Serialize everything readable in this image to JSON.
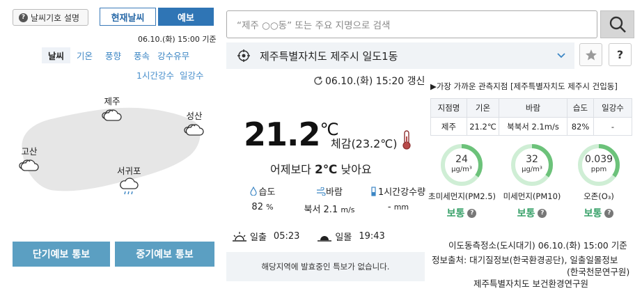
{
  "left": {
    "legend_btn": "날씨기호 설명",
    "tab_now": "현재날씨",
    "tab_fcst": "예보",
    "time": "06.10.(화) 15:00 기준",
    "elements_row1": [
      "날씨",
      "기온",
      "풍향",
      "풍속",
      "강수유무"
    ],
    "elements_row2": [
      "1시간강수",
      "일강수"
    ],
    "cities": [
      "제주",
      "성산",
      "고산",
      "서귀포"
    ],
    "btn_short": "단기예보 통보",
    "btn_mid": "중기예보 통보"
  },
  "search": {
    "placeholder": "“제주 ○○동” 또는 주요 지명으로 검색"
  },
  "location": {
    "name": "제주특별자치도 제주시 일도1동"
  },
  "current": {
    "update": "06.10.(화) 15:20 갱신",
    "temp": "21.2",
    "temp_unit": "℃",
    "feel": "체감(23.2℃)",
    "compare_pre": "어제보다 ",
    "compare_val": "2℃",
    "compare_post": " 낮아요",
    "humidity_label": "습도",
    "humidity_val": "82",
    "humidity_unit": "%",
    "wind_label": "바람",
    "wind_val": "북서 2.1",
    "wind_unit": "m/s",
    "rain_label": "1시간강수량",
    "rain_val": "-",
    "rain_unit": "mm",
    "sunrise_label": "일출",
    "sunrise": "05:23",
    "sunset_label": "일몰",
    "sunset": "19:43",
    "notice": "해당지역에 발효중인 특보가 없습니다."
  },
  "obs": {
    "title": "▶가장 가까운 관측지점 [제주특별자치도 제주시 건입동]",
    "headers": [
      "지점명",
      "기온",
      "바람",
      "습도",
      "일강수"
    ],
    "row": [
      "제주",
      "21.2℃",
      "북북서 2.1m/s",
      "82%",
      "-"
    ]
  },
  "air": {
    "items": [
      {
        "value": "24",
        "unit": "μg/m³",
        "label": "초미세먼지(PM2.5)",
        "grade": "보통",
        "level": 0.35
      },
      {
        "value": "32",
        "unit": "μg/m³",
        "label": "미세먼지(PM10)",
        "grade": "보통",
        "level": 0.35
      },
      {
        "value": "0.039",
        "unit": "ppm",
        "label": "오존(O₃)",
        "grade": "보통",
        "level": 0.35
      }
    ],
    "time": "이도동측정소(도시대기) 06.10.(화) 15:00 기준",
    "source_line1": "정보출처: 대기질정보(한국환경공단), 일출일몰정보",
    "source_line2": "(한국천문연구원)",
    "source_line3": "제주특별자치도 보건환경연구원"
  },
  "colors": {
    "accent": "#2f75b5",
    "button": "#5b9fc2",
    "good": "#38a169",
    "ring": "#6cc27a"
  }
}
